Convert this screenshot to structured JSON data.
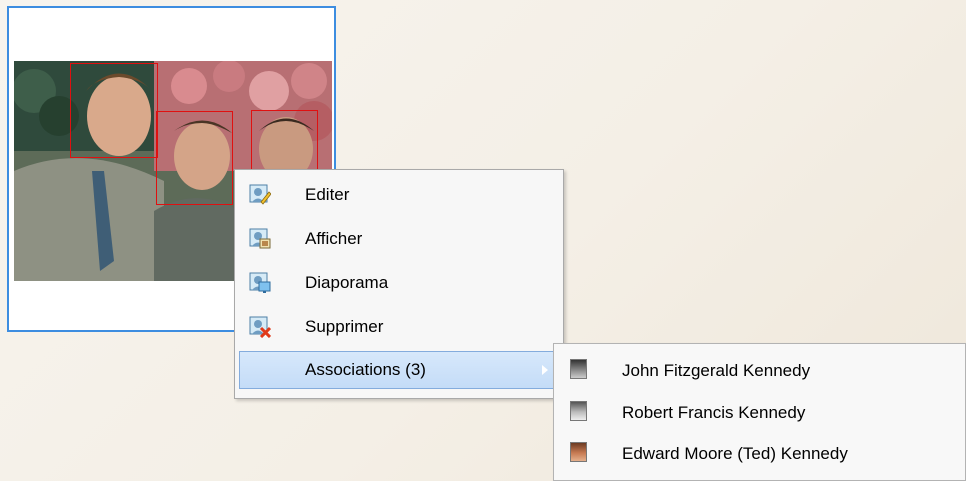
{
  "menu": {
    "items": [
      {
        "label": "Editer",
        "icon": "edit-icon"
      },
      {
        "label": "Afficher",
        "icon": "view-icon"
      },
      {
        "label": "Diaporama",
        "icon": "slideshow-icon"
      },
      {
        "label": "Supprimer",
        "icon": "delete-icon"
      },
      {
        "label": "Associations (3)",
        "icon": "submenu-arrow-icon"
      }
    ]
  },
  "submenu": {
    "items": [
      {
        "label": "John Fitzgerald Kennedy",
        "icon": "person-thumbnail"
      },
      {
        "label": "Robert Francis Kennedy",
        "icon": "person-thumbnail"
      },
      {
        "label": "Edward Moore (Ted) Kennedy",
        "icon": "person-thumbnail"
      }
    ]
  },
  "colors": {
    "card_border": "#3d8de0",
    "face_box": "#e01010",
    "highlight": "#c4dcf7",
    "delete_x": "#e03a1a"
  }
}
